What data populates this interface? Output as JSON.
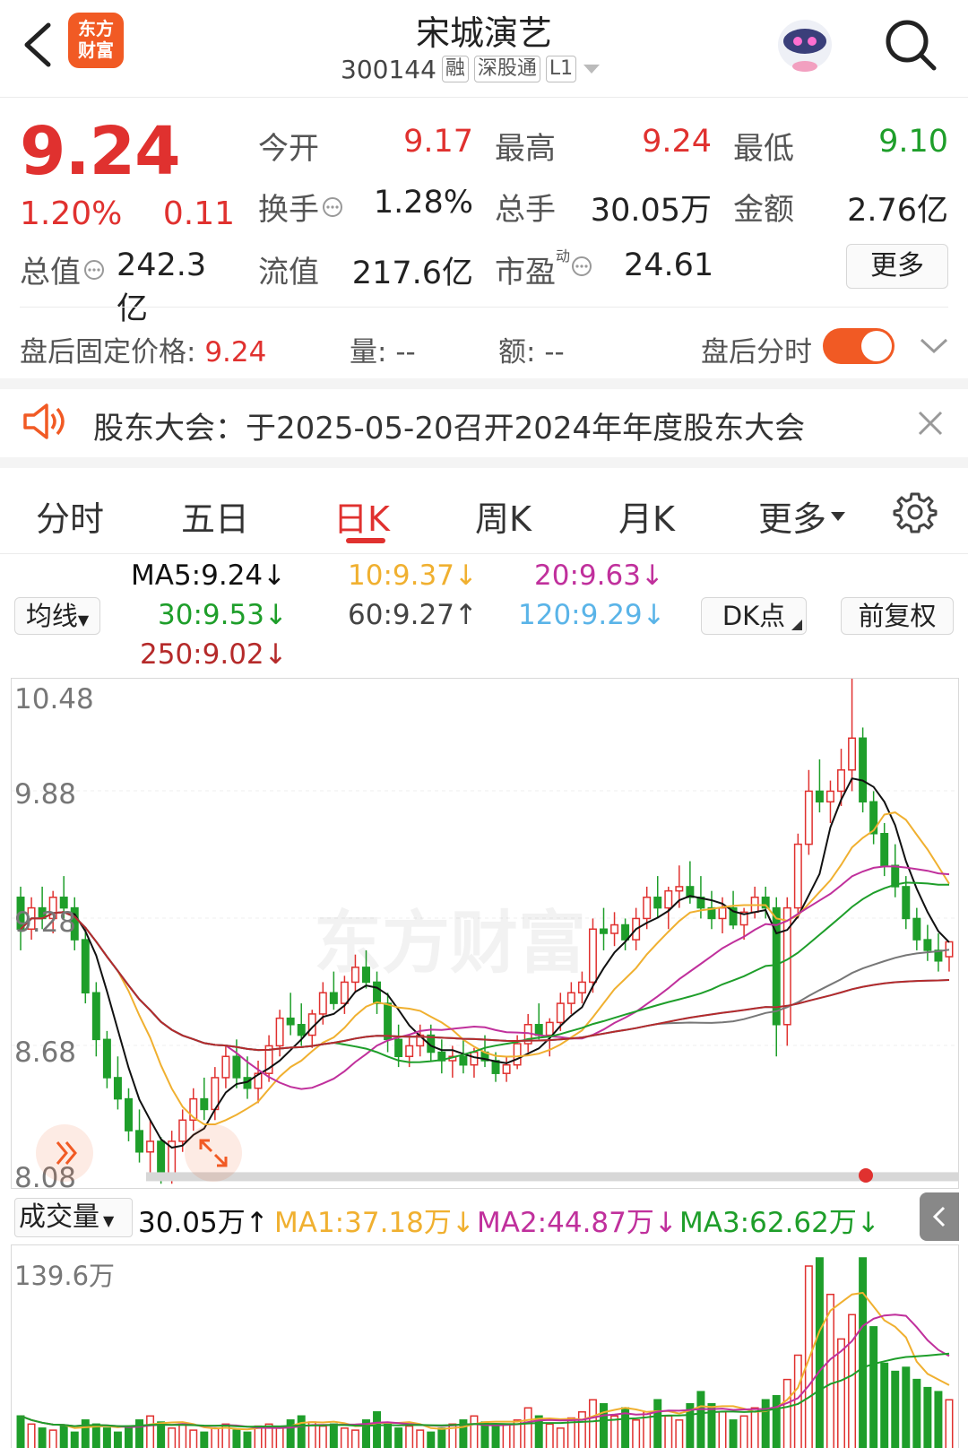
{
  "header": {
    "logo_text": "东方财富",
    "stock_name": "宋城演艺",
    "stock_code": "300144",
    "badges": [
      "融",
      "深股通",
      "L1"
    ]
  },
  "quote": {
    "price": "9.24",
    "change_pct": "1.20%",
    "change": "0.11",
    "open_label": "今开",
    "open": "9.17",
    "high_label": "最高",
    "high": "9.24",
    "low_label": "最低",
    "low": "9.10",
    "turnover_label": "换手",
    "turnover": "1.28%",
    "volume_label": "总手",
    "volume": "30.05万",
    "amount_label": "金额",
    "amount": "2.76亿",
    "mktcap_label": "总值",
    "mktcap": "242.3亿",
    "float_label": "流值",
    "float": "217.6亿",
    "pe_label": "市盈",
    "pe_sup": "动",
    "pe": "24.61",
    "more_button": "更多"
  },
  "after_hours": {
    "price_label": "盘后固定价格:",
    "price": "9.24",
    "vol_label": "量:",
    "vol": "--",
    "amt_label": "额:",
    "amt": "--",
    "toggle_label": "盘后分时"
  },
  "notice": {
    "text": "股东大会：于2025-05-20召开2024年年度股东大会"
  },
  "tabs": [
    "分时",
    "五日",
    "日K",
    "周K",
    "月K",
    "更多"
  ],
  "active_tab": "日K",
  "ma_bar": {
    "selector": "均线",
    "ma5": "MA5:9.24",
    "ma10": "10:9.37",
    "ma20": "20:9.63",
    "ma30": "30:9.53",
    "ma60": "60:9.27",
    "ma120": "120:9.29",
    "ma250": "250:9.02",
    "dk_button": "DK点",
    "fq_button": "前复权"
  },
  "price_axis": [
    "10.48",
    "9.88",
    "9.28",
    "8.68",
    "8.08"
  ],
  "vol_bar": {
    "selector": "成交量",
    "vol": "30.05万",
    "ma1": "MA1:37.18万",
    "ma2": "MA2:44.87万",
    "ma3": "MA3:62.62万"
  },
  "vol_axis": [
    "139.6万"
  ],
  "colors": {
    "up": "#e0312f",
    "down": "#1e9e2a",
    "ma5": "#111111",
    "ma10": "#f0b030",
    "ma20": "#c0309c",
    "ma30": "#1e9e2a",
    "ma60": "#777777",
    "ma120": "#5ab4e8",
    "ma250": "#b52a2a"
  },
  "chart_data": {
    "type": "candlestick",
    "ylim": [
      8.08,
      10.48
    ],
    "candles": [
      [
        9.45,
        9.5,
        9.2,
        9.3
      ],
      [
        9.3,
        9.45,
        9.25,
        9.4
      ],
      [
        9.4,
        9.5,
        9.3,
        9.35
      ],
      [
        9.35,
        9.48,
        9.28,
        9.45
      ],
      [
        9.45,
        9.55,
        9.35,
        9.4
      ],
      [
        9.4,
        9.45,
        9.2,
        9.25
      ],
      [
        9.25,
        9.3,
        8.95,
        9.0
      ],
      [
        9.0,
        9.05,
        8.7,
        8.78
      ],
      [
        8.78,
        8.82,
        8.55,
        8.6
      ],
      [
        8.6,
        8.7,
        8.45,
        8.5
      ],
      [
        8.5,
        8.55,
        8.3,
        8.35
      ],
      [
        8.35,
        8.45,
        8.2,
        8.25
      ],
      [
        8.25,
        8.4,
        8.15,
        8.3
      ],
      [
        8.3,
        8.32,
        8.1,
        8.15
      ],
      [
        8.15,
        8.35,
        8.1,
        8.3
      ],
      [
        8.3,
        8.45,
        8.25,
        8.4
      ],
      [
        8.4,
        8.55,
        8.35,
        8.5
      ],
      [
        8.5,
        8.6,
        8.4,
        8.45
      ],
      [
        8.45,
        8.65,
        8.4,
        8.6
      ],
      [
        8.6,
        8.75,
        8.55,
        8.7
      ],
      [
        8.7,
        8.78,
        8.55,
        8.6
      ],
      [
        8.6,
        8.7,
        8.5,
        8.55
      ],
      [
        8.55,
        8.68,
        8.48,
        8.62
      ],
      [
        8.62,
        8.8,
        8.58,
        8.75
      ],
      [
        8.75,
        8.92,
        8.7,
        8.88
      ],
      [
        8.88,
        9.0,
        8.8,
        8.85
      ],
      [
        8.85,
        8.95,
        8.75,
        8.8
      ],
      [
        8.8,
        8.92,
        8.74,
        8.9
      ],
      [
        8.9,
        9.05,
        8.85,
        9.0
      ],
      [
        9.0,
        9.1,
        8.92,
        8.95
      ],
      [
        8.95,
        9.08,
        8.9,
        9.05
      ],
      [
        9.05,
        9.18,
        9.0,
        9.12
      ],
      [
        9.12,
        9.2,
        9.02,
        9.05
      ],
      [
        9.05,
        9.1,
        8.9,
        8.95
      ],
      [
        8.95,
        9.0,
        8.72,
        8.78
      ],
      [
        8.78,
        8.85,
        8.65,
        8.7
      ],
      [
        8.7,
        8.8,
        8.65,
        8.75
      ],
      [
        8.75,
        8.85,
        8.7,
        8.8
      ],
      [
        8.8,
        8.85,
        8.68,
        8.72
      ],
      [
        8.72,
        8.78,
        8.62,
        8.68
      ],
      [
        8.68,
        8.75,
        8.6,
        8.7
      ],
      [
        8.7,
        8.78,
        8.62,
        8.66
      ],
      [
        8.66,
        8.74,
        8.6,
        8.72
      ],
      [
        8.72,
        8.8,
        8.65,
        8.68
      ],
      [
        8.68,
        8.72,
        8.58,
        8.62
      ],
      [
        8.62,
        8.7,
        8.58,
        8.66
      ],
      [
        8.66,
        8.8,
        8.64,
        8.76
      ],
      [
        8.76,
        8.9,
        8.72,
        8.85
      ],
      [
        8.85,
        8.95,
        8.78,
        8.8
      ],
      [
        8.8,
        8.88,
        8.7,
        8.86
      ],
      [
        8.86,
        9.0,
        8.82,
        8.95
      ],
      [
        8.95,
        9.05,
        8.9,
        9.0
      ],
      [
        9.0,
        9.1,
        8.95,
        9.05
      ],
      [
        9.05,
        9.35,
        9.0,
        9.3
      ],
      [
        9.3,
        9.4,
        9.2,
        9.28
      ],
      [
        9.28,
        9.38,
        9.22,
        9.32
      ],
      [
        9.32,
        9.35,
        9.2,
        9.25
      ],
      [
        9.25,
        9.4,
        9.2,
        9.35
      ],
      [
        9.35,
        9.5,
        9.3,
        9.45
      ],
      [
        9.45,
        9.55,
        9.35,
        9.4
      ],
      [
        9.4,
        9.5,
        9.3,
        9.48
      ],
      [
        9.48,
        9.6,
        9.4,
        9.5
      ],
      [
        9.5,
        9.62,
        9.42,
        9.45
      ],
      [
        9.45,
        9.55,
        9.35,
        9.4
      ],
      [
        9.4,
        9.48,
        9.3,
        9.35
      ],
      [
        9.35,
        9.45,
        9.28,
        9.4
      ],
      [
        9.4,
        9.48,
        9.3,
        9.32
      ],
      [
        9.32,
        9.4,
        9.25,
        9.38
      ],
      [
        9.38,
        9.5,
        9.35,
        9.45
      ],
      [
        9.45,
        9.5,
        9.35,
        9.4
      ],
      [
        9.4,
        9.45,
        8.7,
        8.85
      ],
      [
        8.85,
        9.45,
        8.75,
        9.4
      ],
      [
        9.4,
        9.75,
        9.35,
        9.7
      ],
      [
        9.7,
        10.05,
        9.65,
        9.95
      ],
      [
        9.95,
        10.1,
        9.85,
        9.9
      ],
      [
        9.9,
        10.0,
        9.8,
        9.95
      ],
      [
        9.95,
        10.15,
        9.88,
        10.05
      ],
      [
        10.05,
        10.48,
        9.95,
        10.2
      ],
      [
        10.2,
        10.25,
        9.85,
        9.9
      ],
      [
        9.9,
        9.95,
        9.7,
        9.75
      ],
      [
        9.75,
        9.8,
        9.55,
        9.6
      ],
      [
        9.6,
        9.7,
        9.45,
        9.5
      ],
      [
        9.5,
        9.55,
        9.3,
        9.35
      ],
      [
        9.35,
        9.4,
        9.2,
        9.25
      ],
      [
        9.25,
        9.32,
        9.15,
        9.2
      ],
      [
        9.2,
        9.28,
        9.1,
        9.15
      ],
      [
        9.17,
        9.24,
        9.1,
        9.24
      ]
    ],
    "volumes": [
      22,
      18,
      16,
      15,
      17,
      14,
      20,
      18,
      16,
      14,
      17,
      20,
      22,
      19,
      16,
      18,
      15,
      14,
      16,
      18,
      15,
      14,
      17,
      18,
      16,
      20,
      22,
      19,
      17,
      18,
      16,
      15,
      20,
      24,
      18,
      16,
      17,
      15,
      14,
      16,
      18,
      20,
      22,
      19,
      17,
      18,
      20,
      26,
      22,
      18,
      16,
      21,
      24,
      30,
      28,
      22,
      26,
      20,
      24,
      30,
      22,
      20,
      28,
      34,
      28,
      24,
      20,
      22,
      26,
      30,
      32,
      40,
      52,
      96,
      100,
      82,
      60,
      72,
      100,
      66,
      48,
      44,
      46,
      40,
      36,
      34,
      30
    ]
  }
}
